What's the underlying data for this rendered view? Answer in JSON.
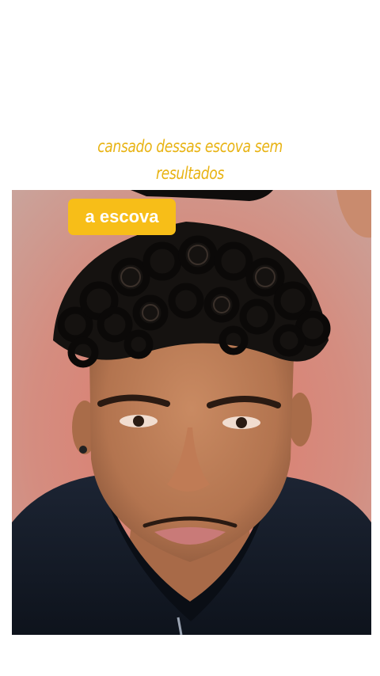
{
  "caption": {
    "line1": "cansado dessas escova sem",
    "line2": "resultados"
  },
  "badge": {
    "label": "a escova"
  },
  "colors": {
    "caption": "#e8b313",
    "badge_bg": "#f7be18",
    "badge_text": "#ffffff",
    "background": "#ffffff"
  }
}
